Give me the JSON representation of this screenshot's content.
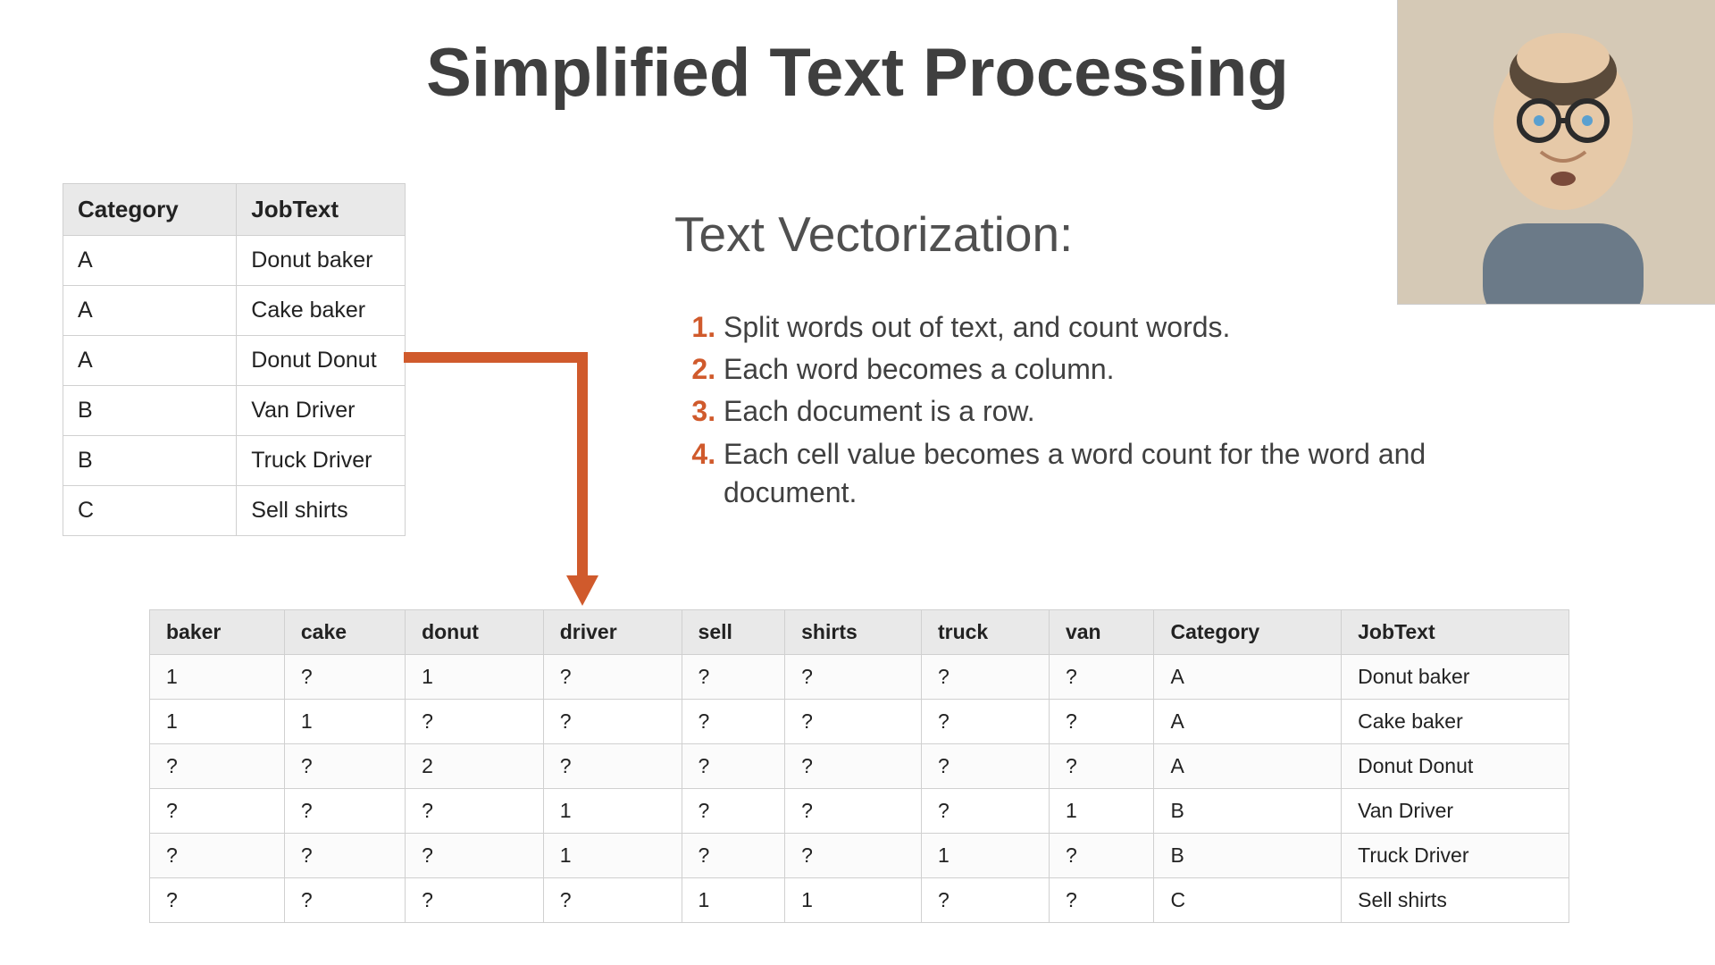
{
  "title": "Simplified Text Processing",
  "subheading": "Text Vectorization:",
  "steps": [
    "Split words out of text, and count words.",
    "Each word becomes a column.",
    "Each document is a row.",
    "Each cell value becomes a word count for the word and document."
  ],
  "top_table": {
    "headers": [
      "Category",
      "JobText"
    ],
    "rows": [
      [
        "A",
        "Donut baker"
      ],
      [
        "A",
        "Cake baker"
      ],
      [
        "A",
        "Donut Donut"
      ],
      [
        "B",
        "Van Driver"
      ],
      [
        "B",
        "Truck Driver"
      ],
      [
        "C",
        "Sell shirts"
      ]
    ]
  },
  "bottom_table": {
    "headers": [
      "baker",
      "cake",
      "donut",
      "driver",
      "sell",
      "shirts",
      "truck",
      "van",
      "Category",
      "JobText"
    ],
    "rows": [
      [
        "1",
        "?",
        "1",
        "?",
        "?",
        "?",
        "?",
        "?",
        "A",
        "Donut baker"
      ],
      [
        "1",
        "1",
        "?",
        "?",
        "?",
        "?",
        "?",
        "?",
        "A",
        "Cake baker"
      ],
      [
        "?",
        "?",
        "2",
        "?",
        "?",
        "?",
        "?",
        "?",
        "A",
        "Donut Donut"
      ],
      [
        "?",
        "?",
        "?",
        "1",
        "?",
        "?",
        "?",
        "1",
        "B",
        "Van Driver"
      ],
      [
        "?",
        "?",
        "?",
        "1",
        "?",
        "?",
        "1",
        "?",
        "B",
        "Truck Driver"
      ],
      [
        "?",
        "?",
        "?",
        "?",
        "1",
        "1",
        "?",
        "?",
        "C",
        "Sell shirts"
      ]
    ]
  }
}
